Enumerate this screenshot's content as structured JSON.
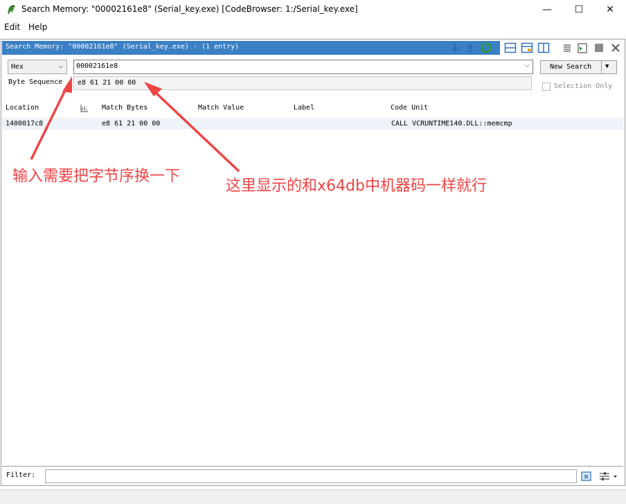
{
  "window": {
    "title": "Search Memory: \"00002161e8\"  (Serial_key.exe) [CodeBrowser: 1:/Serial_key.exe]",
    "minimize": "—",
    "maximize": "☐",
    "close": "✕"
  },
  "menu": {
    "edit": "Edit",
    "help": "Help"
  },
  "panel": {
    "tab_title": "Search Memory: \"00002161e8\"  (Serial_key.exe) -  (1 entry)"
  },
  "search": {
    "format": "Hex",
    "format_chevron": "⌵",
    "value": "00002161e8",
    "dropdown_chevron": "⌵",
    "new_search_label": "New Search",
    "new_search_arrow": "▼",
    "byte_sequence_label": "Byte Sequence",
    "byte_sequence_value": "e8 61 21 00 00",
    "selection_only_label": "Selection Only"
  },
  "table": {
    "columns": [
      "Location",
      "Match Bytes",
      "Match Value",
      "Label",
      "Code Unit"
    ],
    "rows": [
      {
        "location": "1400017c8",
        "match_bytes": "e8 61 21 00 00",
        "match_value": "",
        "label": "",
        "code_unit": "CALL VCRUNTIME140.DLL::memcmp"
      }
    ]
  },
  "annotations": {
    "left": "输入需要把字节序换一下",
    "right": "这里显示的和x64db中机器码一样就行"
  },
  "filter": {
    "label": "Filter:",
    "value": ""
  },
  "colors": {
    "tab_blue": "#3b7fc4",
    "annotation_red": "#ef4444",
    "row_highlight": "#eef3fa"
  },
  "icons": [
    "dragon-app-icon",
    "arrow-down-icon",
    "arrow-up-icon",
    "refresh-icon",
    "layout-icons",
    "filter-clear-icon",
    "filter-options-icon"
  ]
}
